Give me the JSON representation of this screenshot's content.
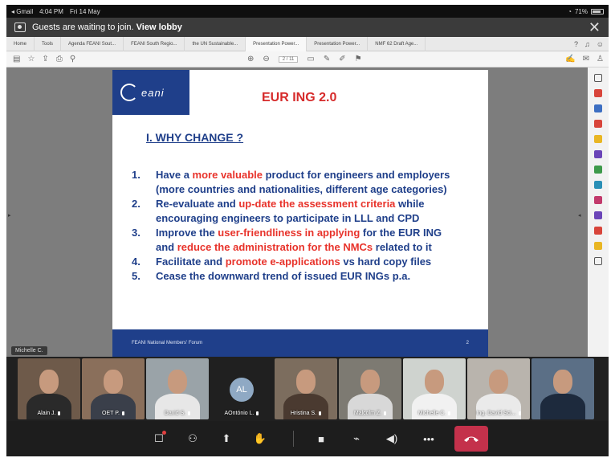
{
  "status_bar": {
    "back_app": "◂ Gmail",
    "time": "4:04 PM",
    "date": "Fri 14 May",
    "battery": "71%"
  },
  "banner": {
    "message_prefix": "Guests are waiting to join.",
    "action": "View lobby"
  },
  "tabs": [
    "Home",
    "Tools",
    "Agenda FEANI Sout...",
    "FEANI South Regio...",
    "the UN Sustainable...",
    "Presentation Power...",
    "Presentation Power...",
    "NMF 62 Draft Age..."
  ],
  "toolbar": {
    "page_indicator": "2 / 11"
  },
  "slide": {
    "logo_text": "eani",
    "title": "EUR ING 2.0",
    "heading": "I. WHY CHANGE ?",
    "items": [
      {
        "num": "1.",
        "segments": [
          {
            "t": "Have a ",
            "red": false
          },
          {
            "t": "more valuable",
            "red": true
          },
          {
            "t": " product for engineers and  employers",
            "red": false
          },
          {
            "t": "(more countries and nationalities, different age categories)",
            "red": false,
            "br": true
          }
        ]
      },
      {
        "num": "2.",
        "segments": [
          {
            "t": "Re-evaluate  and  ",
            "red": false
          },
          {
            "t": "up-date  the  assessment  criteria",
            "red": true
          },
          {
            "t": "  while",
            "red": false
          },
          {
            "t": "encouraging engineers to participate in LLL and CPD",
            "red": false,
            "br": true
          }
        ]
      },
      {
        "num": "3.",
        "segments": [
          {
            "t": "Improve  the  ",
            "red": false
          },
          {
            "t": "user-friendliness  in  applying",
            "red": true
          },
          {
            "t": "  for  the  EUR  ING",
            "red": false
          },
          {
            "t": "and ",
            "red": false,
            "br": true
          },
          {
            "t": "reduce the administration for the NMCs",
            "red": true
          },
          {
            "t": " related to it",
            "red": false
          }
        ]
      },
      {
        "num": "4.",
        "segments": [
          {
            "t": "Facilitate and ",
            "red": false
          },
          {
            "t": "promote e-applications",
            "red": true
          },
          {
            "t": " vs hard copy files",
            "red": false
          }
        ]
      },
      {
        "num": "5.",
        "segments": [
          {
            "t": "Cease the downward trend of issued EUR INGs p.a.",
            "red": false
          }
        ]
      }
    ],
    "footer_text": "FEANI National Members' Forum",
    "footer_page": "2"
  },
  "presenter_label": "Michelle C.",
  "participants": [
    {
      "name": "Alain J.",
      "bg": "#6e5a4a",
      "shirt": "#2a2a2a"
    },
    {
      "name": "OET P.",
      "bg": "#8a6f5b",
      "shirt": "#3a3f4a"
    },
    {
      "name": "David S.",
      "bg": "#9aa3a8",
      "shirt": "#e7e7e7"
    },
    {
      "name": "AOntónio L.",
      "initials": "AL",
      "avatar": true
    },
    {
      "name": "Hristina S.",
      "bg": "#7c6d5e",
      "shirt": "#4a3a30"
    },
    {
      "name": "Malcolm Z.",
      "bg": "#7d7a72",
      "shirt": "#d8d8d8"
    },
    {
      "name": "Michelle C.",
      "bg": "#cfd3cf",
      "shirt": "#f1f1f1"
    },
    {
      "name": "Ing. David Sci...",
      "bg": "#b9b4ad",
      "shirt": "#eaeaea"
    },
    {
      "name": "",
      "bg": "#5b6f86",
      "shirt": "#1d2a3d"
    }
  ],
  "controls": [
    "chat-icon",
    "people-icon",
    "share-icon",
    "raise-hand-icon",
    "camera-icon",
    "mic-off-icon",
    "speaker-icon",
    "more-icon",
    "hang-up-icon"
  ]
}
